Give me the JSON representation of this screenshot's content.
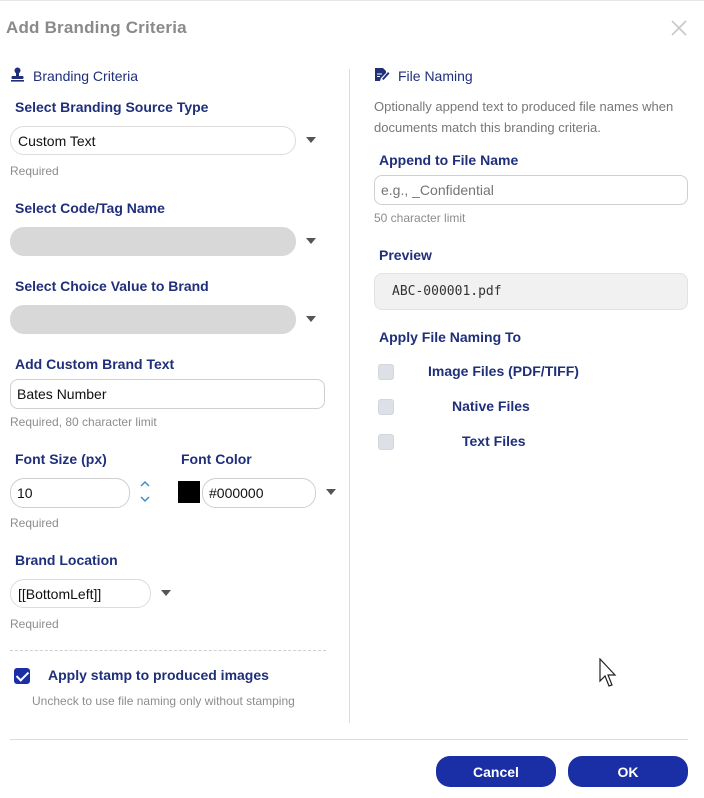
{
  "dialog": {
    "title": "Add Branding Criteria"
  },
  "left": {
    "section_title": "Branding Criteria",
    "source_type": {
      "label": "Select Branding Source Type",
      "value": "Custom Text",
      "hint": "Required"
    },
    "code_tag": {
      "label": "Select Code/Tag Name",
      "value": ""
    },
    "choice_value": {
      "label": "Select Choice Value to Brand",
      "value": ""
    },
    "custom_text": {
      "label": "Add Custom Brand Text",
      "value": "Bates Number",
      "hint": "Required, 80 character limit"
    },
    "font_size": {
      "label": "Font Size (px)",
      "value": "10",
      "hint": "Required"
    },
    "font_color": {
      "label": "Font Color",
      "value": "#000000",
      "swatch": "#000000"
    },
    "location": {
      "label": "Brand Location",
      "value": "[[BottomLeft]]",
      "hint": "Required"
    },
    "apply_stamp": {
      "label": "Apply stamp to produced images",
      "checked": true,
      "hint": "Uncheck to use file naming only without stamping"
    }
  },
  "right": {
    "section_title": "File Naming",
    "description": "Optionally append text to produced file names when documents match this branding criteria.",
    "append": {
      "label": "Append to File Name",
      "placeholder": "e.g., _Confidential",
      "hint": "50 character limit"
    },
    "preview": {
      "label": "Preview",
      "value": "ABC-000001.pdf"
    },
    "apply_to": {
      "label": "Apply File Naming To",
      "options": [
        {
          "label": "Image Files (PDF/TIFF)",
          "checked": false
        },
        {
          "label": "Native Files",
          "checked": false
        },
        {
          "label": "Text Files",
          "checked": false
        }
      ]
    }
  },
  "footer": {
    "cancel_label": "Cancel",
    "ok_label": "OK"
  },
  "colors": {
    "primary": "#1a2ea5",
    "label": "#1f2f7a",
    "hint": "#8d8d8d",
    "disabled_field": "#d8d8d8"
  }
}
